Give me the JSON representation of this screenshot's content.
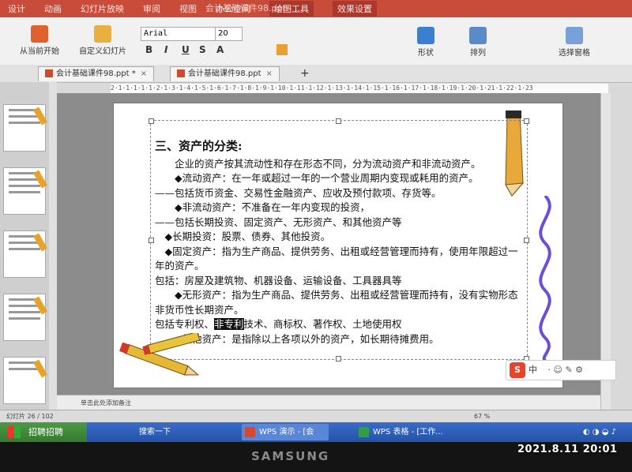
{
  "window": {
    "title": "会计基础课件98.ppt - ..."
  },
  "menu": {
    "items": [
      "设计",
      "动画",
      "幻灯片放映",
      "审阅",
      "视图",
      "办公空间",
      "绘图工具",
      "效果设置"
    ]
  },
  "ribbon": {
    "start_from_current": "从当前开始",
    "custom_show": "自定义幻灯片",
    "font_name": "Arial",
    "font_size": "20",
    "shape": "形状",
    "arrange": "排列",
    "select_pane": "选择窗格"
  },
  "tabs": [
    {
      "label": "会计基础课件98.ppt *"
    },
    {
      "label": "会计基础课件98.ppt"
    },
    {
      "label": "+"
    }
  ],
  "ruler": {
    "text": "2·1·1·1·1·1·2·1·3·1·4·1·5·1·6·1·7·1·8·1·9·1·10·1·11·1·12·1·13·1·14·1·15·1·16·1·17·1·18·1·19·1·20·1·21·1·22·1·23"
  },
  "slide": {
    "heading": "三、资产的分类:",
    "lines": [
      "企业的资产按其流动性和存在形态不同，分为流动资产和非流动资产。",
      "◆流动资产：在一年或超过一年的一个营业周期内变现或耗用的资产。",
      "——包括货币资金、交易性金融资产、应收及预付款项、存货等。",
      "◆非流动资产：不准备在一年内变现的投资，",
      "——包括长期投资、固定资产、无形资产、和其他资产等",
      "◆长期投资：股票、债券、其他投资。",
      "◆固定资产：指为生产商品、提供劳务、出租或经营管理而持有，使用年限超过一年的资产。",
      "包括：房屋及建筑物、机器设备、运输设备、工具器具等",
      "◆无形资产：指为生产商品、提供劳务、出租或经营管理而持有，没有实物形态非货币性长期资产。",
      "◆其他资产：是指除以上各项以外的资产，如长期待摊费用。"
    ],
    "patent_prefix": "包括专利权、",
    "patent_highlight": "非专利",
    "patent_suffix": "技术、商标权、著作权、土地使用权"
  },
  "notes": {
    "placeholder": "单击此处添加备注"
  },
  "status": {
    "slide_info": "幻灯片 26 / 102",
    "zoom": "67 %"
  },
  "taskbar": {
    "start": "招聘招聘",
    "search": "搜索一下",
    "item1": "WPS 演示 - [会计...",
    "item2": "WPS 表格 - [工作..."
  },
  "ime": {
    "label": "中"
  },
  "monitor": {
    "brand": "SAMSUNG"
  },
  "photo": {
    "timestamp": "2021.8.11 20:01"
  }
}
